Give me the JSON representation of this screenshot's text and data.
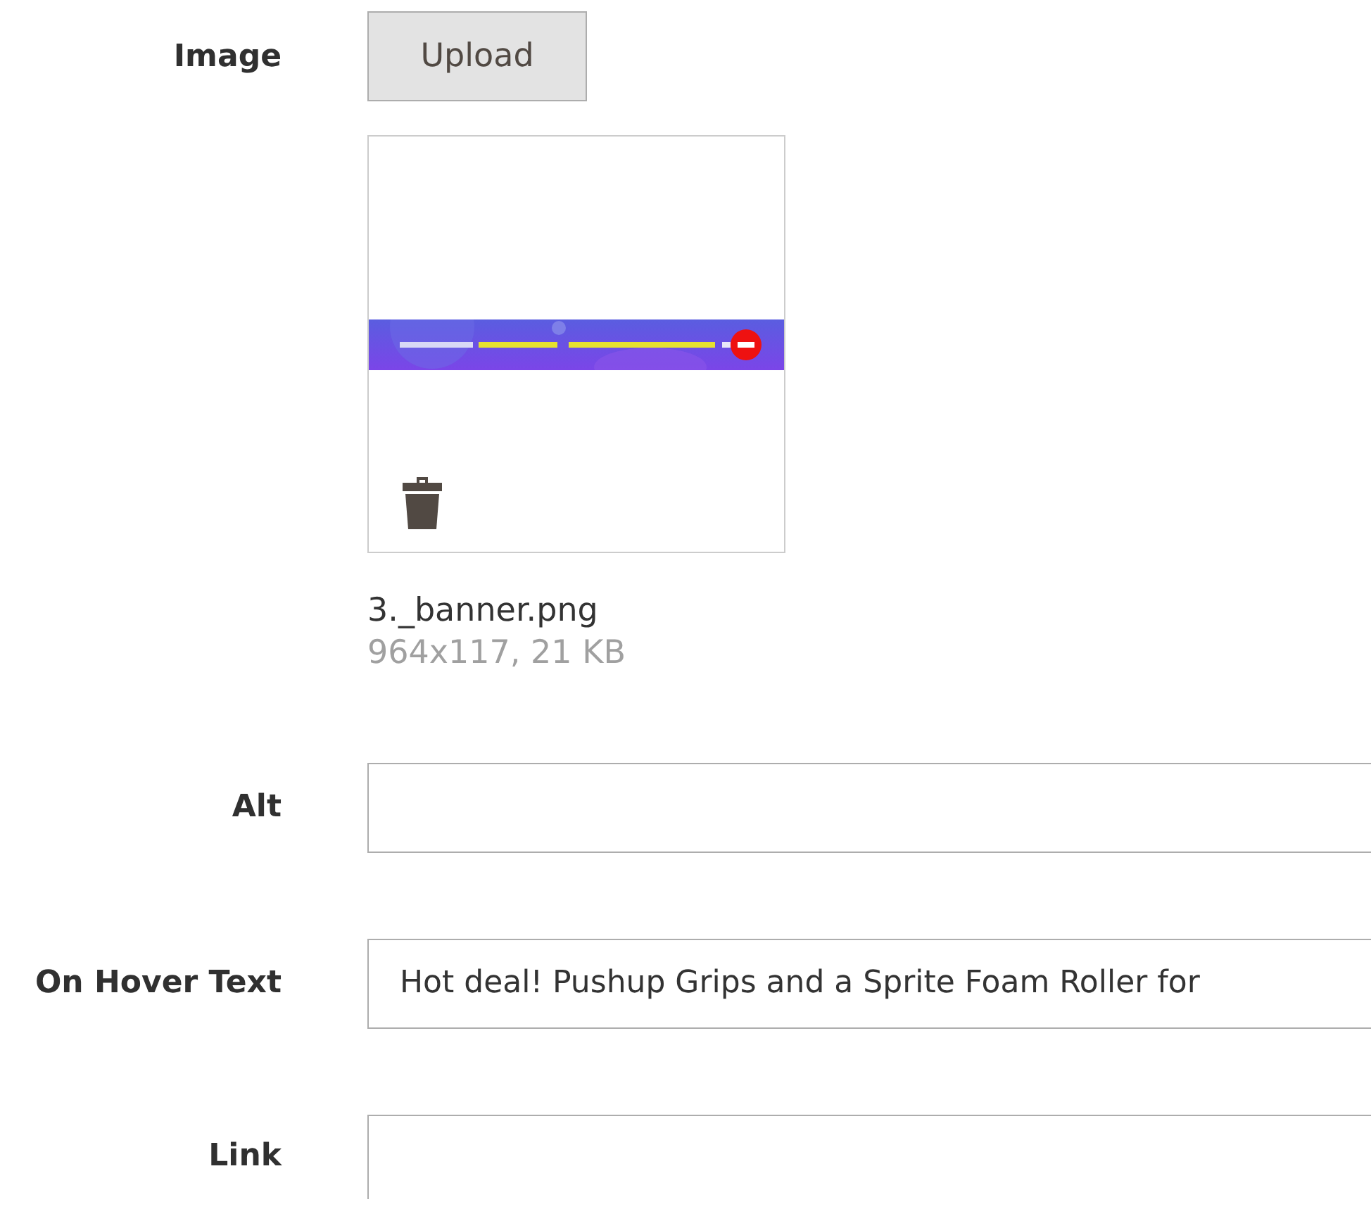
{
  "image": {
    "label": "Image",
    "upload_button": "Upload",
    "file_name": "3._banner.png",
    "file_meta": "964x117, 21 KB"
  },
  "fields": [
    {
      "label": "Alt"
    },
    {
      "label": "On Hover Text",
      "value": "Hot deal! Pushup Grips and a Sprite Foam Roller for"
    },
    {
      "label": "Link"
    }
  ]
}
